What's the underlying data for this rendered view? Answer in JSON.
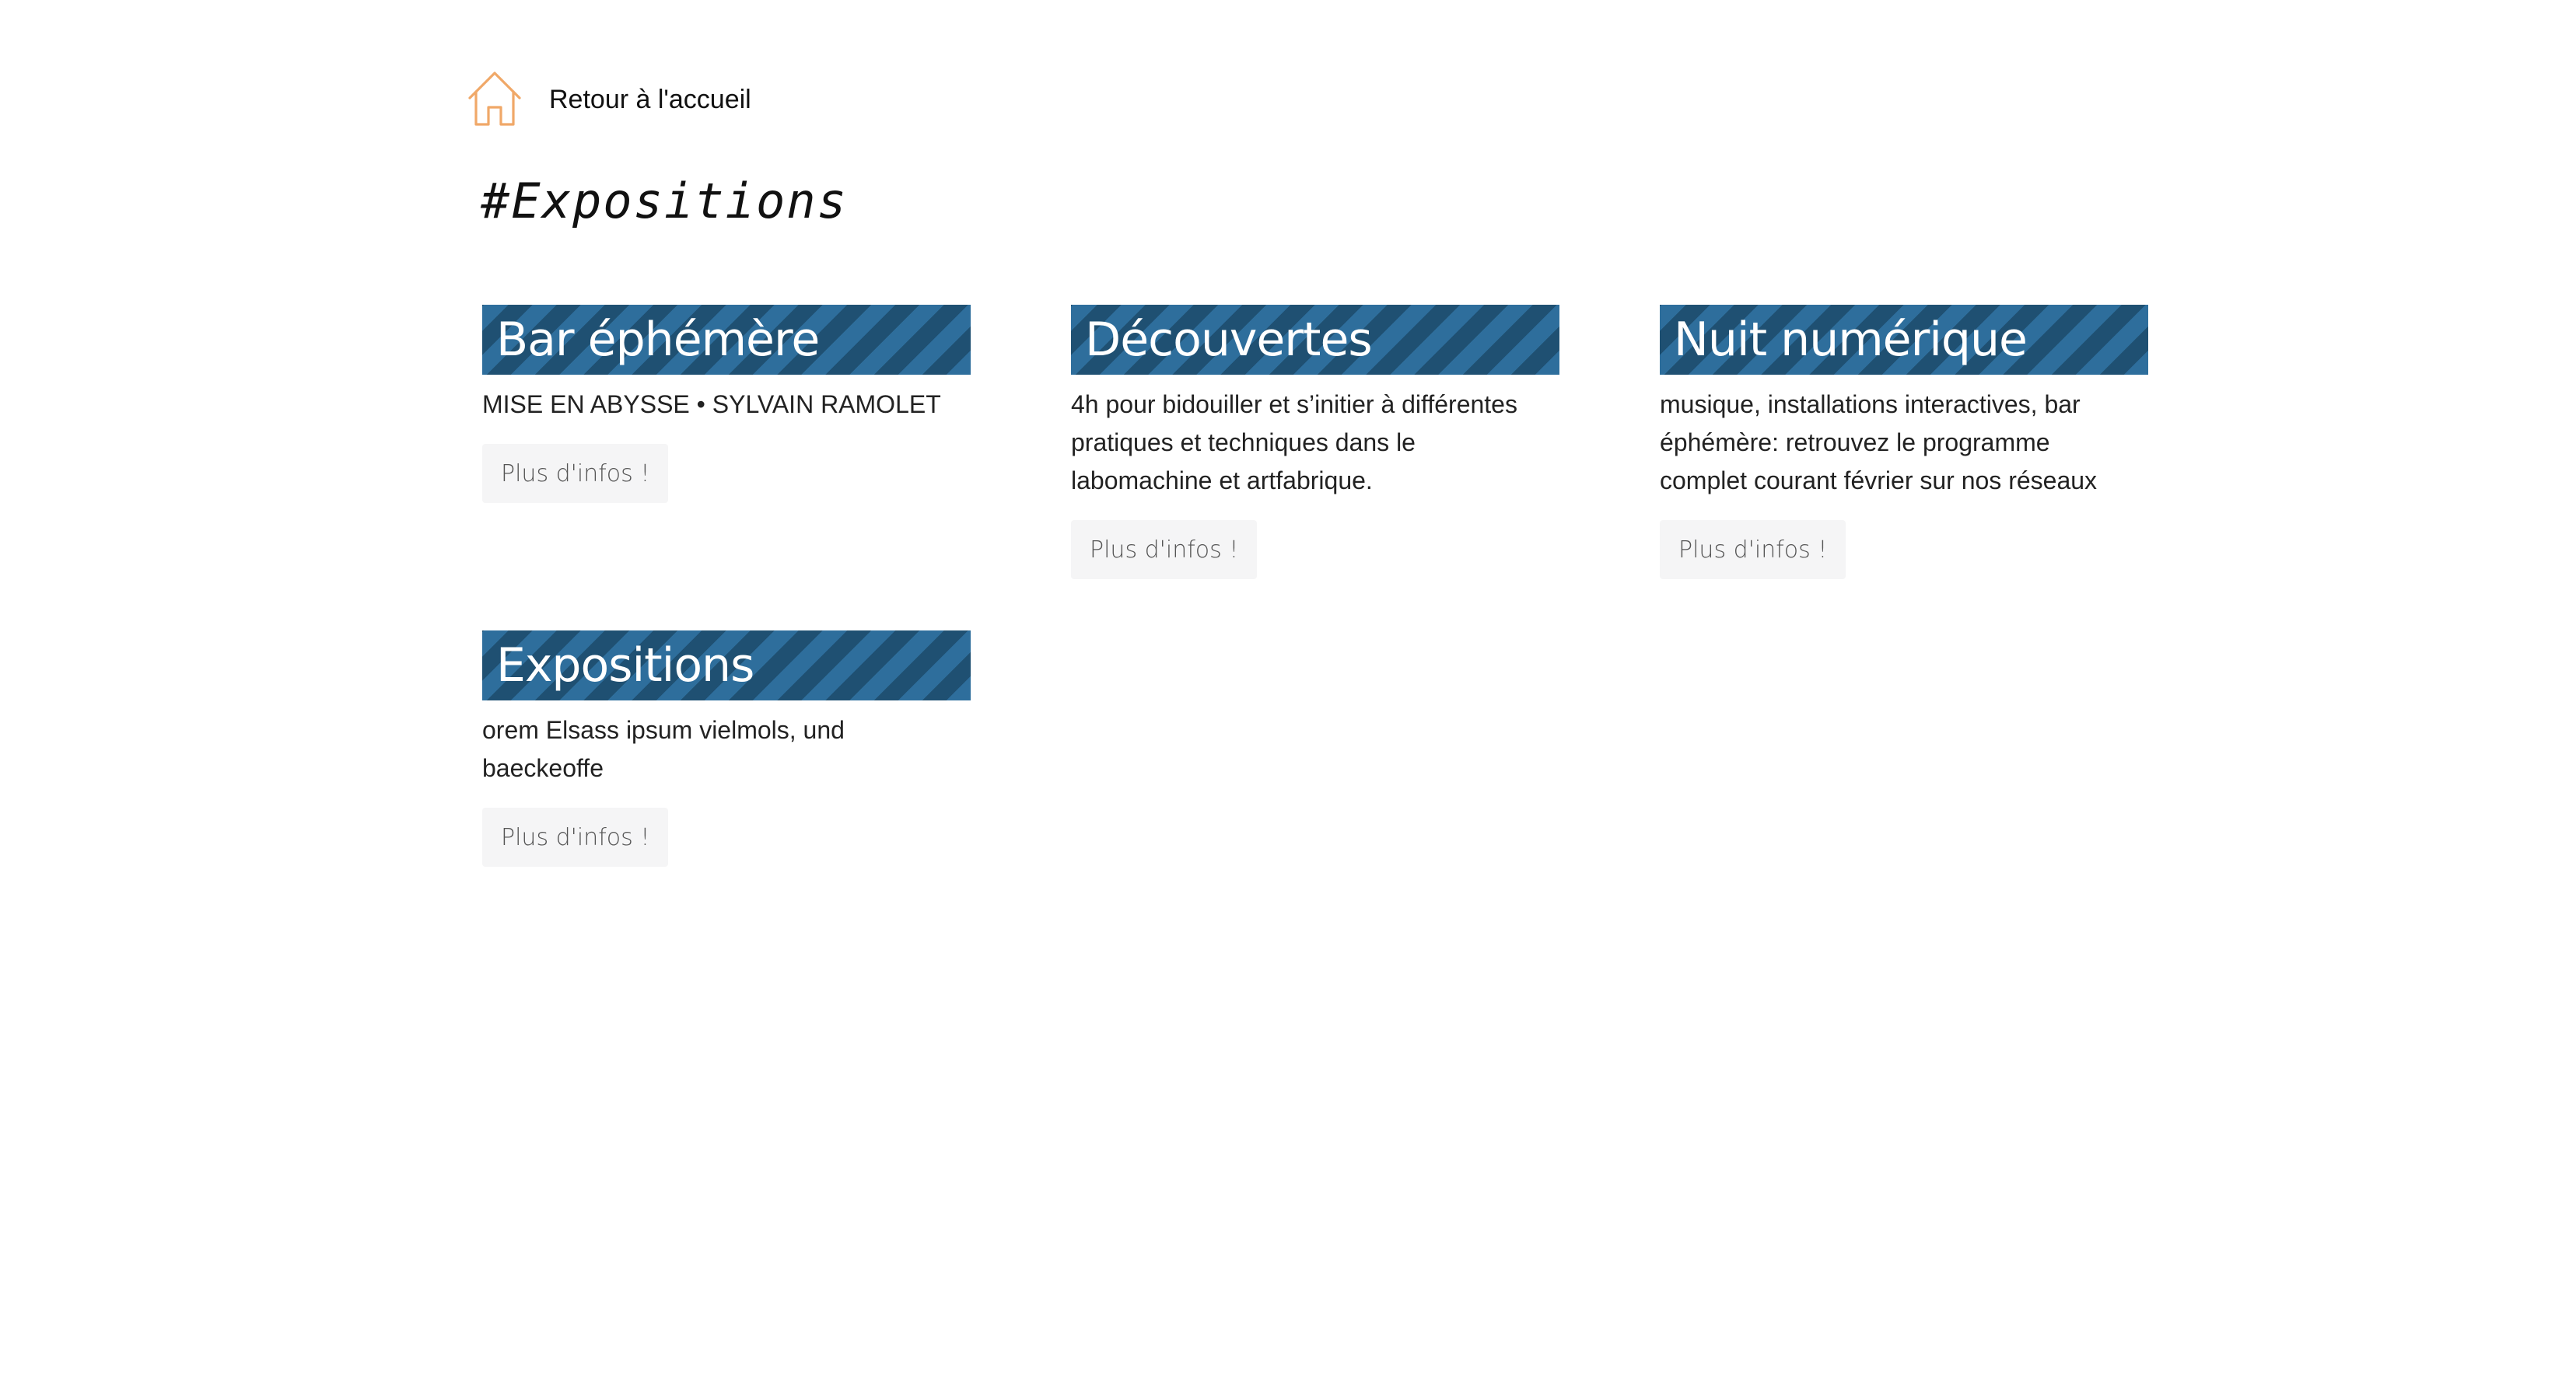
{
  "nav": {
    "home_label": "Retour à l'accueil",
    "home_icon": "home-icon",
    "home_icon_color": "#f0a868"
  },
  "page": {
    "title": "#Expositions"
  },
  "theme": {
    "title_band_color": "#2e6e9c",
    "title_band_stripe": "#1f5072",
    "button_bg": "#f5f5f6"
  },
  "cards": [
    {
      "title": "Bar éphémère",
      "description": "MISE EN ABYSSE • SYLVAIN RAMOLET",
      "button_label": "Plus d'infos !"
    },
    {
      "title": "Découvertes",
      "description": "4h pour bidouiller et s’initier à différentes pratiques et techniques dans le labomachine et artfabrique.",
      "button_label": "Plus d'infos !"
    },
    {
      "title": "Nuit numérique",
      "description": "musique, installations interactives, bar éphémère: retrouvez le programme complet courant février sur nos réseaux",
      "button_label": "Plus d'infos !"
    },
    {
      "title": "Expositions",
      "description": "orem Elsass ipsum vielmols, und baeckeoffe",
      "button_label": "Plus d'infos !"
    }
  ]
}
